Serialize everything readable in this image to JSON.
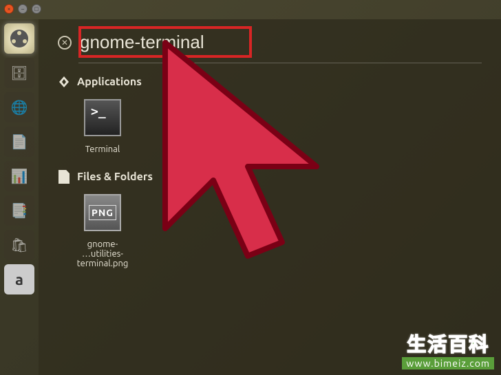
{
  "window": {
    "close_glyph": "×",
    "min_glyph": "−",
    "max_glyph": "□"
  },
  "launcher": {
    "items": [
      {
        "name": "dash",
        "active": true
      },
      {
        "name": "files",
        "glyph": "🗄"
      },
      {
        "name": "firefox",
        "glyph": "🌐"
      },
      {
        "name": "writer",
        "glyph": "📄"
      },
      {
        "name": "calc",
        "glyph": "📊"
      },
      {
        "name": "impress",
        "glyph": "📑"
      },
      {
        "name": "software",
        "glyph": "🛍"
      },
      {
        "name": "amazon",
        "glyph": "a"
      }
    ]
  },
  "search": {
    "value": "gnome-terminal",
    "clear_glyph": "✕"
  },
  "sections": {
    "applications": {
      "label": "Applications",
      "icon_glyph": "A",
      "results": [
        {
          "label": "Terminal"
        }
      ]
    },
    "files": {
      "label": "Files & Folders",
      "results": [
        {
          "label": "gnome-\n…utilities-terminal.png",
          "badge": "PNG"
        }
      ]
    }
  },
  "watermark": {
    "title": "生活百科",
    "url": "www.bimeiz.com"
  },
  "cursor_color": "#d82e4a",
  "cursor_stroke": "#7a0015"
}
